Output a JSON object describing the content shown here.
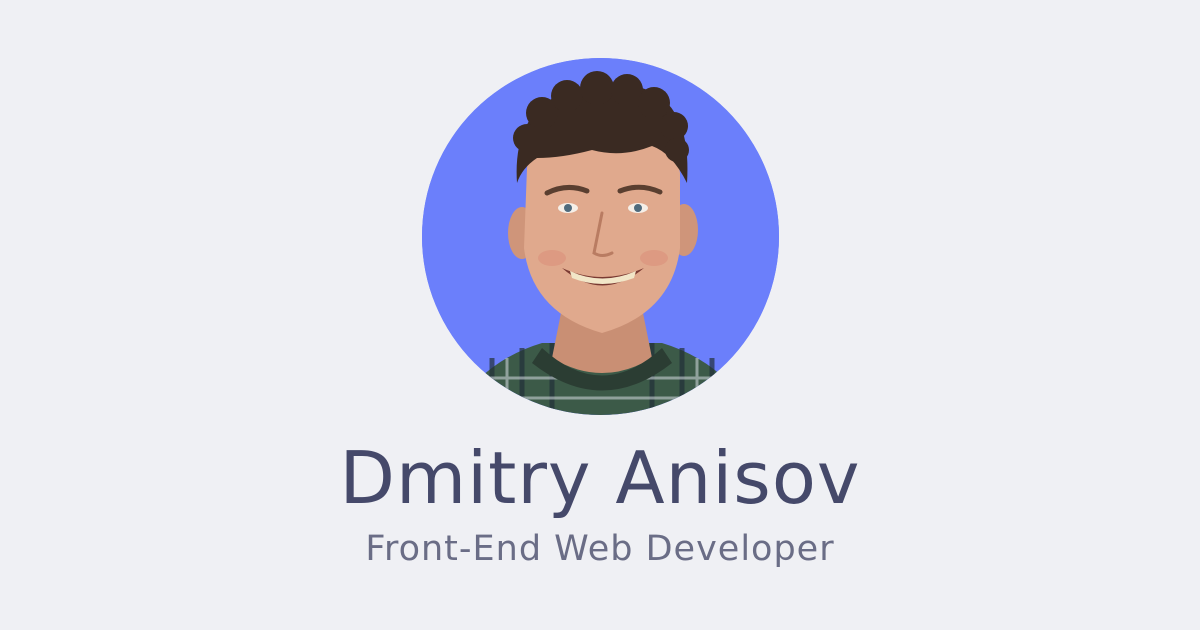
{
  "profile": {
    "name": "Dmitry Anisov",
    "title": "Front-End Web Developer",
    "avatar_icon": "portrait-photo",
    "avatar_background": "#6b7ffb"
  },
  "colors": {
    "page_background": "#eff0f4",
    "name_text": "#45496a",
    "title_text": "#6a6d86"
  }
}
